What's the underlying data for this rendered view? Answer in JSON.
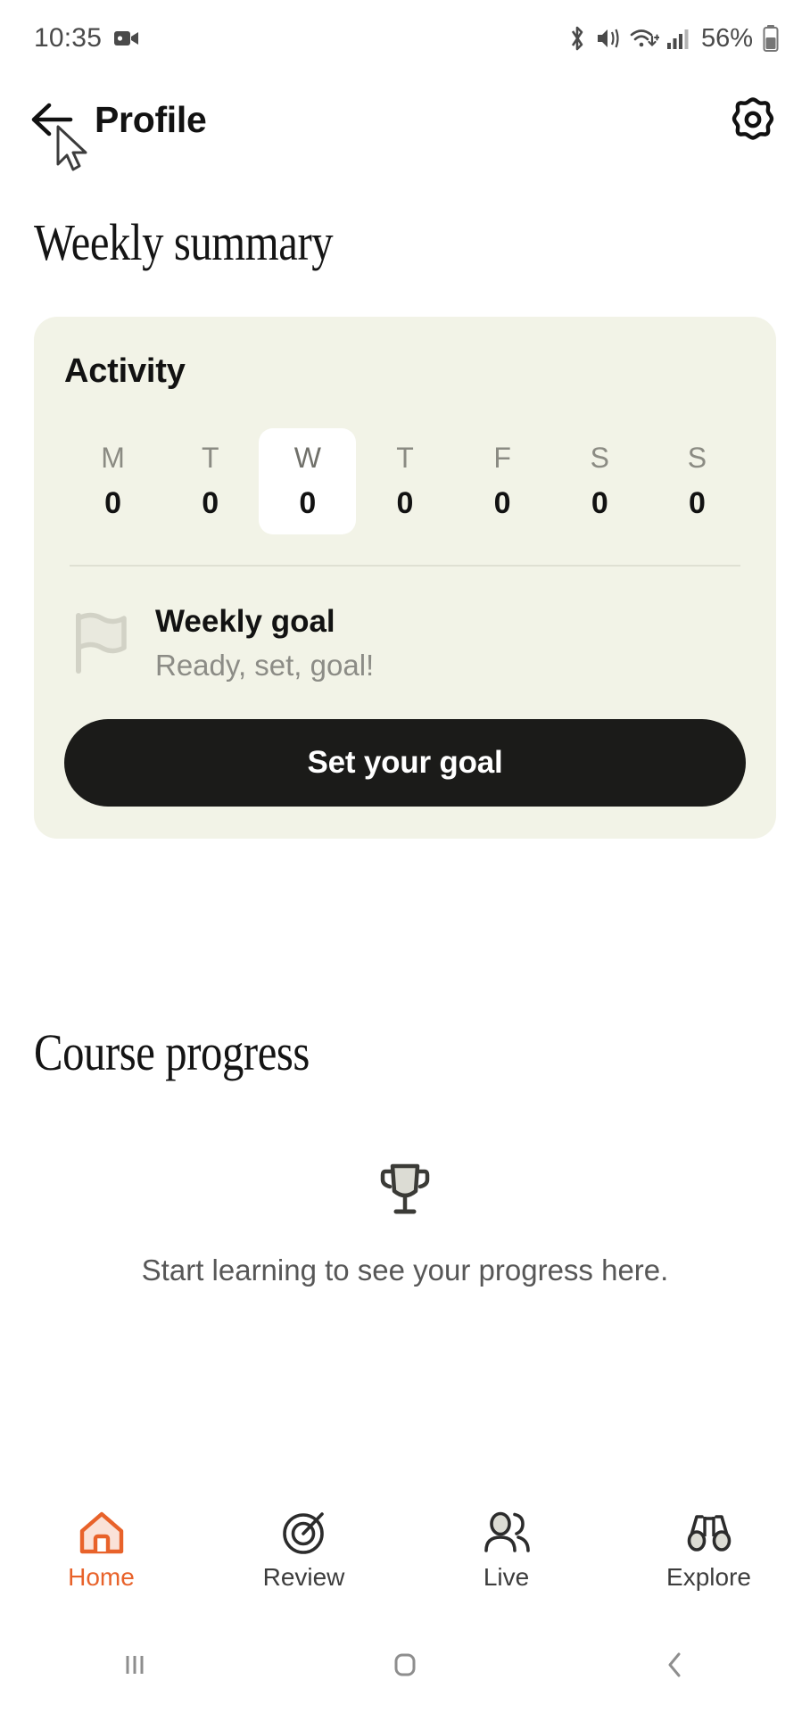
{
  "status_bar": {
    "time": "10:35",
    "battery_percent": "56%",
    "icons": [
      "video-camera-icon",
      "bluetooth-icon",
      "vibrate-icon",
      "wifi-icon",
      "cellular-signal-icon",
      "battery-icon"
    ]
  },
  "app_bar": {
    "title": "Profile",
    "back_icon": "arrow-left-icon",
    "settings_icon": "gear-icon"
  },
  "weekly_summary": {
    "heading": "Weekly summary",
    "activity": {
      "heading": "Activity",
      "days": [
        {
          "letter": "M",
          "value": "0",
          "today": false
        },
        {
          "letter": "T",
          "value": "0",
          "today": false
        },
        {
          "letter": "W",
          "value": "0",
          "today": true
        },
        {
          "letter": "T",
          "value": "0",
          "today": false
        },
        {
          "letter": "F",
          "value": "0",
          "today": false
        },
        {
          "letter": "S",
          "value": "0",
          "today": false
        },
        {
          "letter": "S",
          "value": "0",
          "today": false
        }
      ],
      "goal": {
        "icon": "flag-icon",
        "title": "Weekly goal",
        "subtitle": "Ready, set, goal!",
        "button_label": "Set your goal"
      }
    }
  },
  "course_progress": {
    "heading": "Course progress",
    "empty_icon": "trophy-icon",
    "empty_text": "Start learning to see your progress here."
  },
  "bottom_nav": {
    "active_color": "#e8622a",
    "items": [
      {
        "label": "Home",
        "icon": "home-icon",
        "active": true
      },
      {
        "label": "Review",
        "icon": "target-icon",
        "active": false
      },
      {
        "label": "Live",
        "icon": "people-icon",
        "active": false
      },
      {
        "label": "Explore",
        "icon": "binoculars-icon",
        "active": false
      }
    ]
  },
  "system_nav": {
    "items": [
      "recents-icon",
      "home-square-icon",
      "back-chevron-icon"
    ]
  }
}
